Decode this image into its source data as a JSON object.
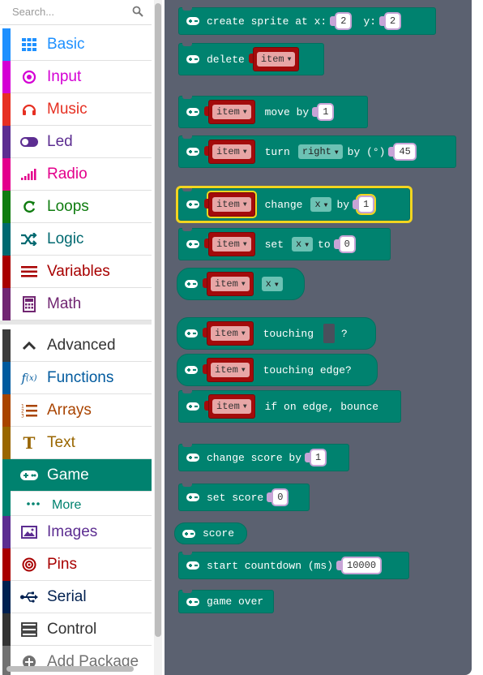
{
  "search": {
    "placeholder": "Search..."
  },
  "categories": [
    {
      "label": "Basic",
      "color": "#1e90ff",
      "icon": "grid-icon"
    },
    {
      "label": "Input",
      "color": "#d400d4",
      "icon": "radio-button-icon"
    },
    {
      "label": "Music",
      "color": "#e63022",
      "icon": "headphones-icon"
    },
    {
      "label": "Led",
      "color": "#5c2d91",
      "icon": "toggle-icon"
    },
    {
      "label": "Radio",
      "color": "#e3008c",
      "icon": "signal-bars-icon"
    },
    {
      "label": "Loops",
      "color": "#107c10",
      "icon": "refresh-icon"
    },
    {
      "label": "Logic",
      "color": "#006970",
      "icon": "shuffle-icon"
    },
    {
      "label": "Variables",
      "color": "#a80000",
      "icon": "list-lines-icon"
    },
    {
      "label": "Math",
      "color": "#712672",
      "icon": "calculator-icon"
    }
  ],
  "advanced": [
    {
      "label": "Advanced",
      "color": "#3c3c3c",
      "icon": "chevron-up-icon"
    },
    {
      "label": "Functions",
      "color": "#005a9e",
      "icon": "function-icon"
    },
    {
      "label": "Arrays",
      "color": "#a94400",
      "icon": "numbered-list-icon"
    },
    {
      "label": "Text",
      "color": "#996600",
      "icon": "text-t-icon"
    },
    {
      "label": "Game",
      "color": "#00826f",
      "icon": "gamepad-icon"
    },
    {
      "label": "More",
      "color": "#00826f",
      "icon": "more-dots-icon"
    },
    {
      "label": "Images",
      "color": "#5c2d91",
      "icon": "image-icon"
    },
    {
      "label": "Pins",
      "color": "#a80000",
      "icon": "target-icon"
    },
    {
      "label": "Serial",
      "color": "#002050",
      "icon": "usb-icon"
    },
    {
      "label": "Control",
      "color": "#333333",
      "icon": "server-icon"
    },
    {
      "label": "Add Package",
      "color": "#717171",
      "icon": "plus-icon"
    }
  ],
  "blocks": {
    "create_sprite": {
      "text": "create sprite at x:",
      "x": "2",
      "y_label": "y:",
      "y": "2"
    },
    "delete": {
      "text": "delete",
      "var": "item"
    },
    "move": {
      "var": "item",
      "text": "move by",
      "value": "1"
    },
    "turn": {
      "var": "item",
      "text": "turn",
      "dir": "right",
      "by": "by (°)",
      "value": "45"
    },
    "change": {
      "var": "item",
      "text": "change",
      "prop": "x",
      "by": "by",
      "value": "1"
    },
    "set": {
      "var": "item",
      "text": "set",
      "prop": "x",
      "to": "to",
      "value": "0"
    },
    "get": {
      "var": "item",
      "prop": "x"
    },
    "touching": {
      "var": "item",
      "text": "touching",
      "q": "?"
    },
    "touching_edge": {
      "var": "item",
      "text": "touching edge?"
    },
    "bounce": {
      "var": "item",
      "text": "if on edge, bounce"
    },
    "change_score": {
      "text": "change score by",
      "value": "1"
    },
    "set_score": {
      "text": "set score",
      "value": "0"
    },
    "score": {
      "text": "score"
    },
    "countdown": {
      "text": "start countdown (ms)",
      "value": "10000"
    },
    "game_over": {
      "text": "game over"
    }
  }
}
